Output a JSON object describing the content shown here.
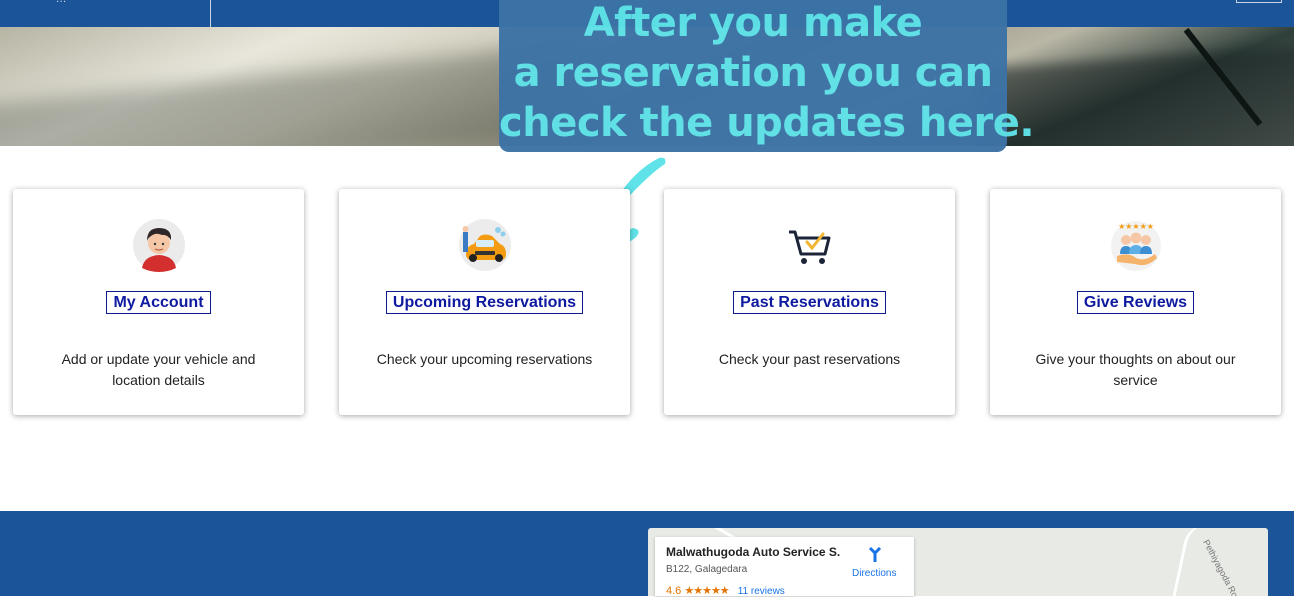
{
  "header": {
    "logo_text": "...",
    "colors": {
      "bar": "#1b5499"
    }
  },
  "callout": {
    "line1": "After you make",
    "line2": "a reservation you can",
    "line3": "check the updates here.",
    "colors": {
      "box": "#3d73a6",
      "text": "#5fe3e8"
    }
  },
  "cards": [
    {
      "icon": "user-avatar-icon",
      "title": "My Account",
      "description": "Add or update your vehicle and location details"
    },
    {
      "icon": "car-service-icon",
      "title": "Upcoming Reservations",
      "description": "Check your upcoming reservations"
    },
    {
      "icon": "shopping-cart-icon",
      "title": "Past Reservations",
      "description": "Check your past reservations"
    },
    {
      "icon": "review-people-icon",
      "title": "Give Reviews",
      "description": "Give your thoughts on about our service"
    }
  ],
  "map": {
    "place_name": "Malwathugoda Auto Service S...",
    "address": "B122, Galagedara",
    "rating": "4.6",
    "stars": "★★★★★",
    "reviews": "11 reviews",
    "directions_label": "Directions",
    "road_label": "Pethiyagoda Road"
  }
}
